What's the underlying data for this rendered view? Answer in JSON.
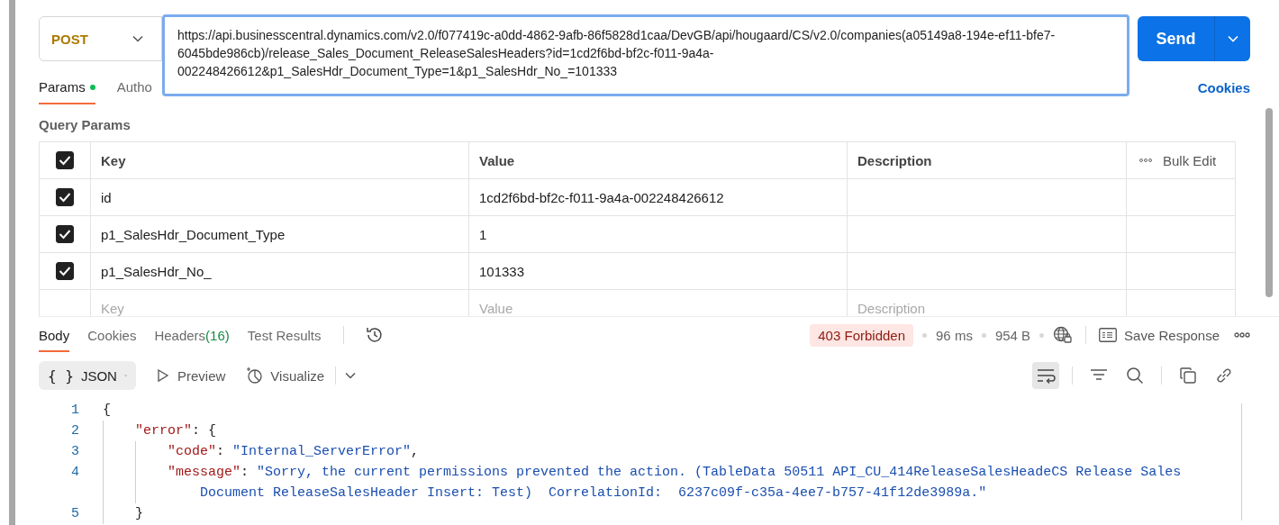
{
  "request": {
    "method": "POST",
    "url": "https://api.businesscentral.dynamics.com/v2.0/f077419c-a0dd-4862-9afb-86f5828d1caa/DevGB/api/hougaard/CS/v2.0/companies(a05149a8-194e-ef11-bfe7-6045bde986cb)/release_Sales_Document_ReleaseSalesHeaders?id=1cd2f6bd-bf2c-f011-9a4a-002248426612&p1_SalesHdr_Document_Type=1&p1_SalesHdr_No_=101333",
    "send": "Send"
  },
  "request_tabs": [
    {
      "label": "Params",
      "selected": true,
      "dot": true
    },
    {
      "label": "Autho",
      "selected": false,
      "dot": false
    }
  ],
  "cookies_link": "Cookies",
  "query_params": {
    "title": "Query Params",
    "all_checked": true,
    "columns": [
      "Key",
      "Value",
      "Description"
    ],
    "bulk_edit": "Bulk Edit",
    "rows": [
      {
        "checked": true,
        "key": "id",
        "value": "1cd2f6bd-bf2c-f011-9a4a-002248426612"
      },
      {
        "checked": true,
        "key": "p1_SalesHdr_Document_Type",
        "value": "1"
      },
      {
        "checked": true,
        "key": "p1_SalesHdr_No_",
        "value": "101333"
      }
    ],
    "new_row": {
      "key": {
        "placeholder": "Key"
      },
      "value": {
        "placeholder": "Value"
      },
      "description": {
        "placeholder": "Description"
      }
    }
  },
  "response_tabs": [
    {
      "label": "Body",
      "selected": true
    },
    {
      "label": "Cookies",
      "selected": false
    },
    {
      "label": "Headers",
      "count": "(16)",
      "selected": false
    },
    {
      "label": "Test Results",
      "selected": false
    }
  ],
  "status": {
    "code": "403 Forbidden",
    "time": "96 ms",
    "size": "954 B",
    "save": "Save Response"
  },
  "body_toolbar": {
    "format_icon": "{ }",
    "format": "JSON",
    "views": [
      {
        "kind": "preview",
        "label": "Preview"
      },
      {
        "kind": "visualize",
        "label": "Visualize"
      }
    ],
    "tools": [
      {
        "kind": "wrap",
        "selected": true
      },
      {
        "kind": "filter",
        "selected": false
      },
      {
        "kind": "search",
        "selected": false
      },
      {
        "kind": "copy",
        "selected": false
      },
      {
        "kind": "link",
        "selected": false
      }
    ]
  },
  "code": [
    {
      "number": "1",
      "tokens": [
        {
          "kind": "punct",
          "text": "{"
        }
      ],
      "children": [
        {
          "number": "2",
          "tokens": [
            {
              "kind": "key",
              "text": "\"error\""
            },
            {
              "kind": "punct",
              "text": ": {"
            }
          ],
          "children": [
            {
              "number": "3",
              "tokens": [
                {
                  "kind": "key",
                  "text": "\"code\""
                },
                {
                  "kind": "punct",
                  "text": ": "
                },
                {
                  "kind": "string",
                  "text": "\"Internal_ServerError\""
                },
                {
                  "kind": "punct",
                  "text": ","
                }
              ]
            },
            {
              "number": "4",
              "tokens": [
                {
                  "kind": "key",
                  "text": "\"message\""
                },
                {
                  "kind": "punct",
                  "text": ": "
                },
                {
                  "kind": "string",
                  "text": "\"Sorry, the current permissions prevented the action. (TableData 50511 API_CU_414ReleaseSalesHeadeCS Release Sales Document ReleaseSalesHeader Insert: Test)  CorrelationId:  6237c09f-c35a-4ee7-b757-41f12de3989a.\""
                }
              ]
            }
          ]
        },
        {
          "number": "5",
          "tokens": [
            {
              "kind": "punct",
              "text": "}"
            }
          ]
        }
      ]
    }
  ]
}
